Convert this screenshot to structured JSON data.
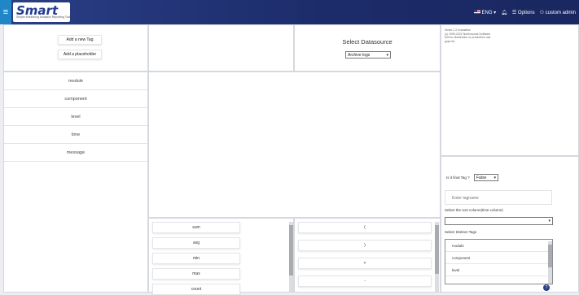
{
  "header": {
    "logo_text": "Smart",
    "logo_tagline": "Simple  Monitoring  Analytics  Reporting  Tool",
    "language": "ENG",
    "options_label": "Options",
    "user_label": "custom admin"
  },
  "tag_buttons": {
    "add_tag": "Add a new Tag",
    "add_placeholder": "Add a placeholder"
  },
  "datasource": {
    "title": "Select Datasource",
    "selected": "Archive logs"
  },
  "columns": [
    "module",
    "component",
    "level",
    "time",
    "message"
  ],
  "legal": {
    "line1": "Smart 1.2 evaluation",
    "line2": "(c) 1999-2022 Northwoods Software",
    "line3": "Not for distribution or production use",
    "line4": "gojs.net"
  },
  "functions": [
    "sum",
    "avg",
    "min",
    "max",
    "count"
  ],
  "operators": [
    "(",
    ")",
    "+",
    "-"
  ],
  "form": {
    "final_tag_label": "Is it final Tag ?",
    "final_tag_value": "False",
    "tagname_placeholder": "Enter tagname",
    "sort_label": "Select the sort column(time column)",
    "sort_value": "",
    "distinct_label": "Select Distinct Tags"
  },
  "distinct_tags": [
    "module",
    "component",
    "level"
  ]
}
